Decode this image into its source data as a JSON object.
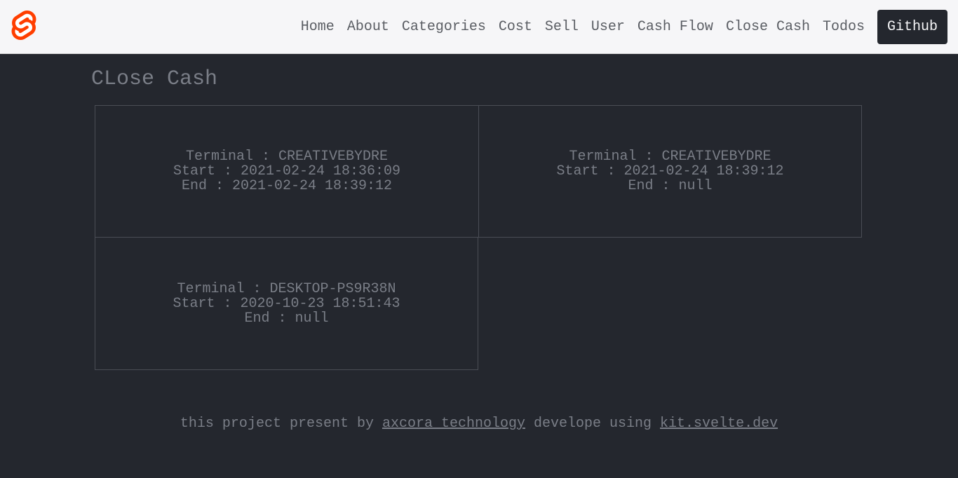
{
  "nav": {
    "home": "Home",
    "about": "About",
    "categories": "Categories",
    "cost": "Cost",
    "sell": "Sell",
    "user": "User",
    "cashflow": "Cash Flow",
    "closecash": "Close Cash",
    "todos": "Todos",
    "github": "Github"
  },
  "page": {
    "title": "CLose Cash"
  },
  "cards": [
    {
      "terminal": "Terminal : CREATIVEBYDRE",
      "start": "Start : 2021-02-24 18:36:09",
      "end": "End : 2021-02-24 18:39:12"
    },
    {
      "terminal": "Terminal : CREATIVEBYDRE",
      "start": "Start : 2021-02-24 18:39:12",
      "end": "End : null"
    },
    {
      "terminal": "Terminal : DESKTOP-PS9R38N",
      "start": "Start : 2020-10-23 18:51:43",
      "end": "End : null"
    }
  ],
  "footer": {
    "prefix": "this project present by ",
    "link1": "axcora technology",
    "middle": " develope using ",
    "link2": "kit.svelte.dev"
  }
}
